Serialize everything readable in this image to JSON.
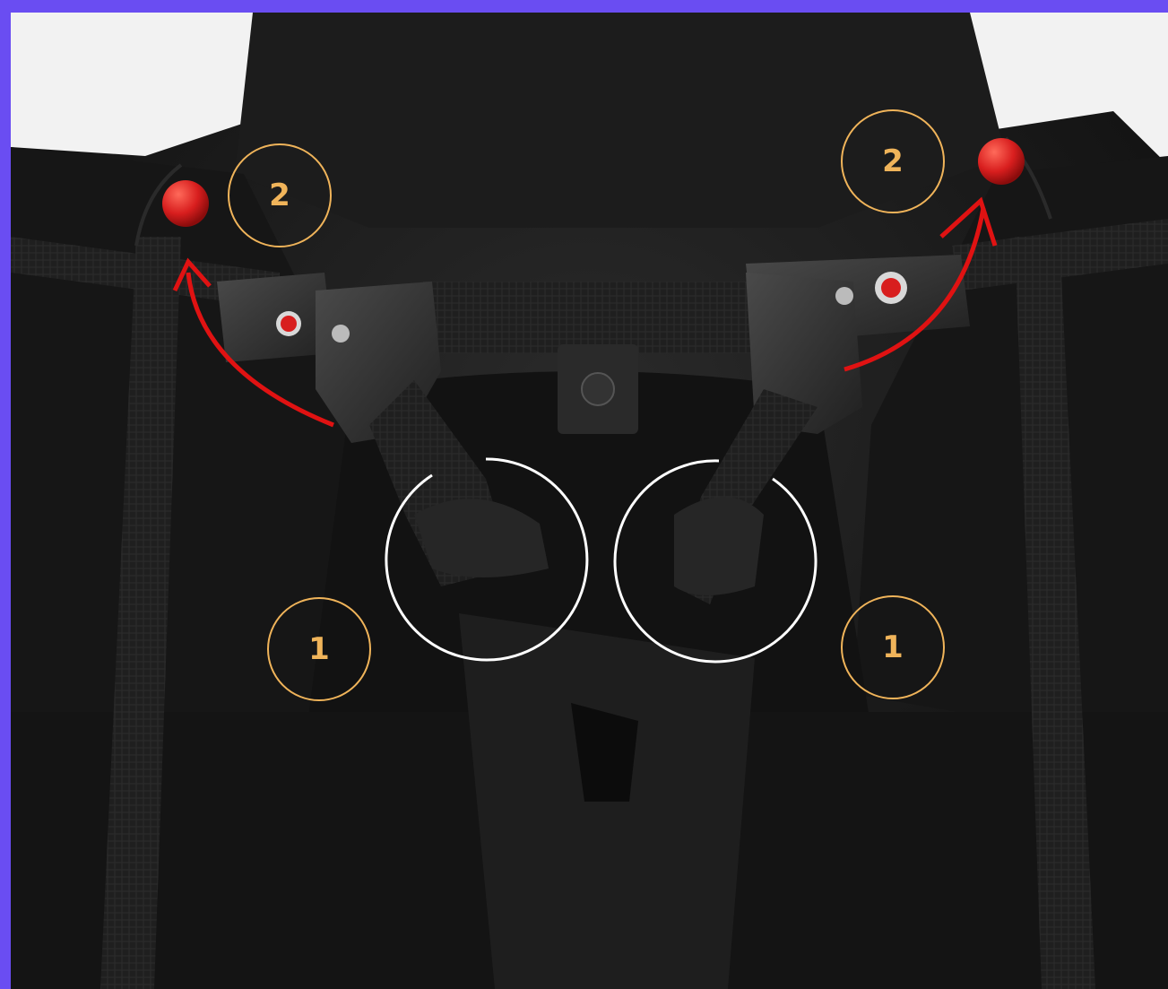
{
  "image": {
    "subject": "paragliding-harness-chest-strap",
    "frame_color": "#6a4df2"
  },
  "markers": [
    {
      "id": "marker-2-left",
      "label": "2",
      "color": "#f0b45a"
    },
    {
      "id": "marker-2-right",
      "label": "2",
      "color": "#f0b45a"
    },
    {
      "id": "marker-1-left",
      "label": "1",
      "color": "#f0b45a"
    },
    {
      "id": "marker-1-right",
      "label": "1",
      "color": "#f0b45a"
    }
  ],
  "annotations": {
    "arrow_color": "#e01212",
    "highlight_circle_color": "#ffffff",
    "bead_color": "#d81e1e"
  }
}
